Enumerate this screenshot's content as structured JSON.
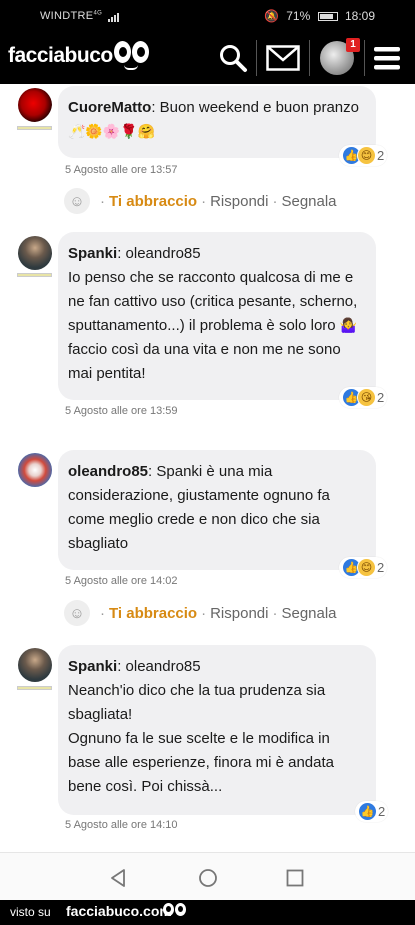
{
  "status_bar": {
    "carrier": "WINDTRE",
    "network": "4G",
    "battery": "71%",
    "time": "18:09"
  },
  "app": {
    "logo_text": "facciabuco",
    "notifications": "1"
  },
  "actions_labels": {
    "hug": "Ti abbraccio",
    "reply": "Rispondi",
    "report": "Segnala",
    "separator": "·"
  },
  "comments": [
    {
      "author": "CuoreMatto",
      "reply_to": "",
      "text": "Buon weekend e buon pranzo",
      "emojis": "🥂🌼🌸🌹🤗",
      "timestamp": "5 Agosto alle ore 13:57",
      "reaction_count": "2",
      "show_actions": true
    },
    {
      "author": "Spanki",
      "reply_to": "oleandro85",
      "text_before_emoji": "Io penso che se racconto qualcosa di me e ne fan cattivo uso (critica pesante, scherno, sputtanamento...) il problema è solo loro",
      "emoji": "🤷‍♀️",
      "text_after_emoji": "faccio così da una vita e non me ne sono mai pentita!",
      "timestamp": "5 Agosto alle ore 13:59",
      "reaction_count": "2"
    },
    {
      "author": "oleandro85",
      "reply_to": "",
      "text": "Spanki è una mia considerazione, giustamente ognuno fa come meglio crede e non dico che sia sbagliato",
      "timestamp": "5 Agosto alle ore 14:02",
      "reaction_count": "2",
      "show_actions": true
    },
    {
      "author": "Spanki",
      "reply_to": "oleandro85",
      "text_line1": "Neanch'io dico che la tua prudenza sia sbagliata!",
      "text_line2": "Ognuno fa le sue scelte e le modifica in base alle esperienze, finora mi è andata bene così. Poi chissà...",
      "timestamp": "5 Agosto alle ore 14:10",
      "reaction_count": "2"
    }
  ],
  "footer": {
    "prefix": "visto su",
    "brand": "facciabuco.com"
  },
  "colors": {
    "hug": "#d78a13",
    "bubble": "#f0f0f2",
    "like": "#2f7ae0",
    "badge": "#e02020"
  }
}
